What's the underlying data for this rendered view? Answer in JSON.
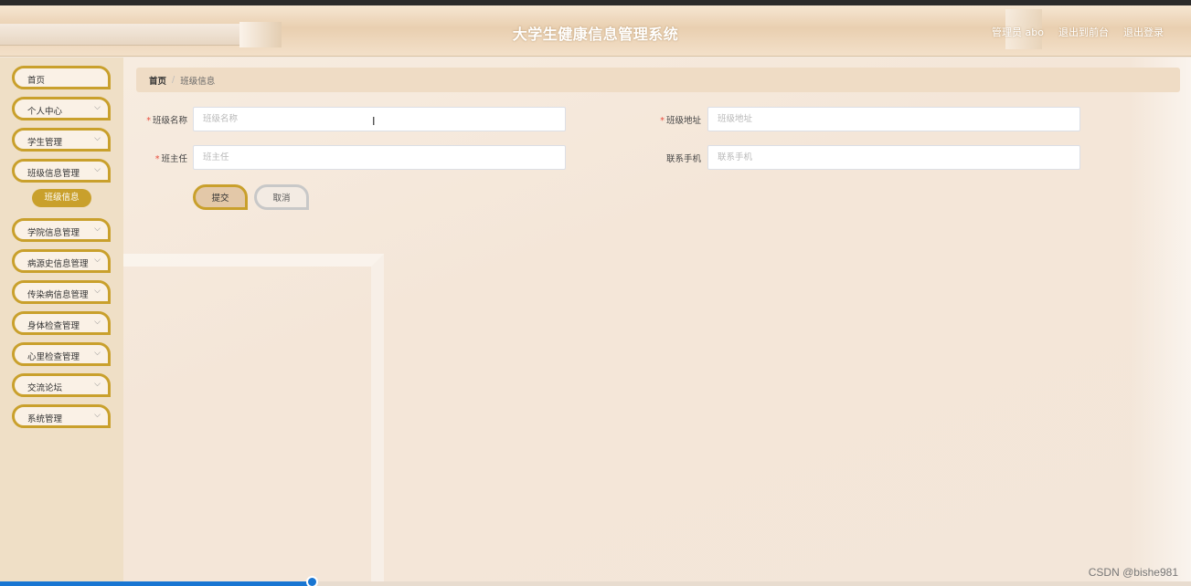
{
  "header": {
    "title": "大学生健康信息管理系统",
    "links": [
      "管理员 abo",
      "退出到前台",
      "退出登录"
    ]
  },
  "sidebar": {
    "items": [
      {
        "label": "首页",
        "has_chevron": false
      },
      {
        "label": "个人中心",
        "has_chevron": true
      },
      {
        "label": "学生管理",
        "has_chevron": true
      },
      {
        "label": "班级信息管理",
        "has_chevron": true
      },
      {
        "label": "学院信息管理",
        "has_chevron": true
      },
      {
        "label": "病源史信息管理",
        "has_chevron": true
      },
      {
        "label": "传染病信息管理",
        "has_chevron": true
      },
      {
        "label": "身体检查管理",
        "has_chevron": true
      },
      {
        "label": "心里检查管理",
        "has_chevron": true
      },
      {
        "label": "交流论坛",
        "has_chevron": true
      },
      {
        "label": "系统管理",
        "has_chevron": true
      }
    ],
    "sub_item": "班级信息",
    "chevron_icon": "chevron-down-icon"
  },
  "breadcrumb": {
    "home": "首页",
    "separator": "/",
    "current": "班级信息"
  },
  "form": {
    "class_name": {
      "label": "班级名称",
      "required": true,
      "placeholder": "班级名称",
      "value": ""
    },
    "class_address": {
      "label": "班级地址",
      "required": true,
      "placeholder": "班级地址",
      "value": ""
    },
    "head_teacher": {
      "label": "班主任",
      "required": true,
      "placeholder": "班主任",
      "value": ""
    },
    "contact_phone": {
      "label": "联系手机",
      "required": false,
      "placeholder": "联系手机",
      "value": ""
    },
    "submit_label": "提交",
    "cancel_label": "取消"
  },
  "watermark": "CSDN @bishe981",
  "colors": {
    "accent": "#c9a02c",
    "sidebar_bg": "#efdfc6",
    "breadcrumb_bg": "#efdcc5",
    "required_mark": "#e84c3d",
    "scrollbar": "#1976d2"
  }
}
